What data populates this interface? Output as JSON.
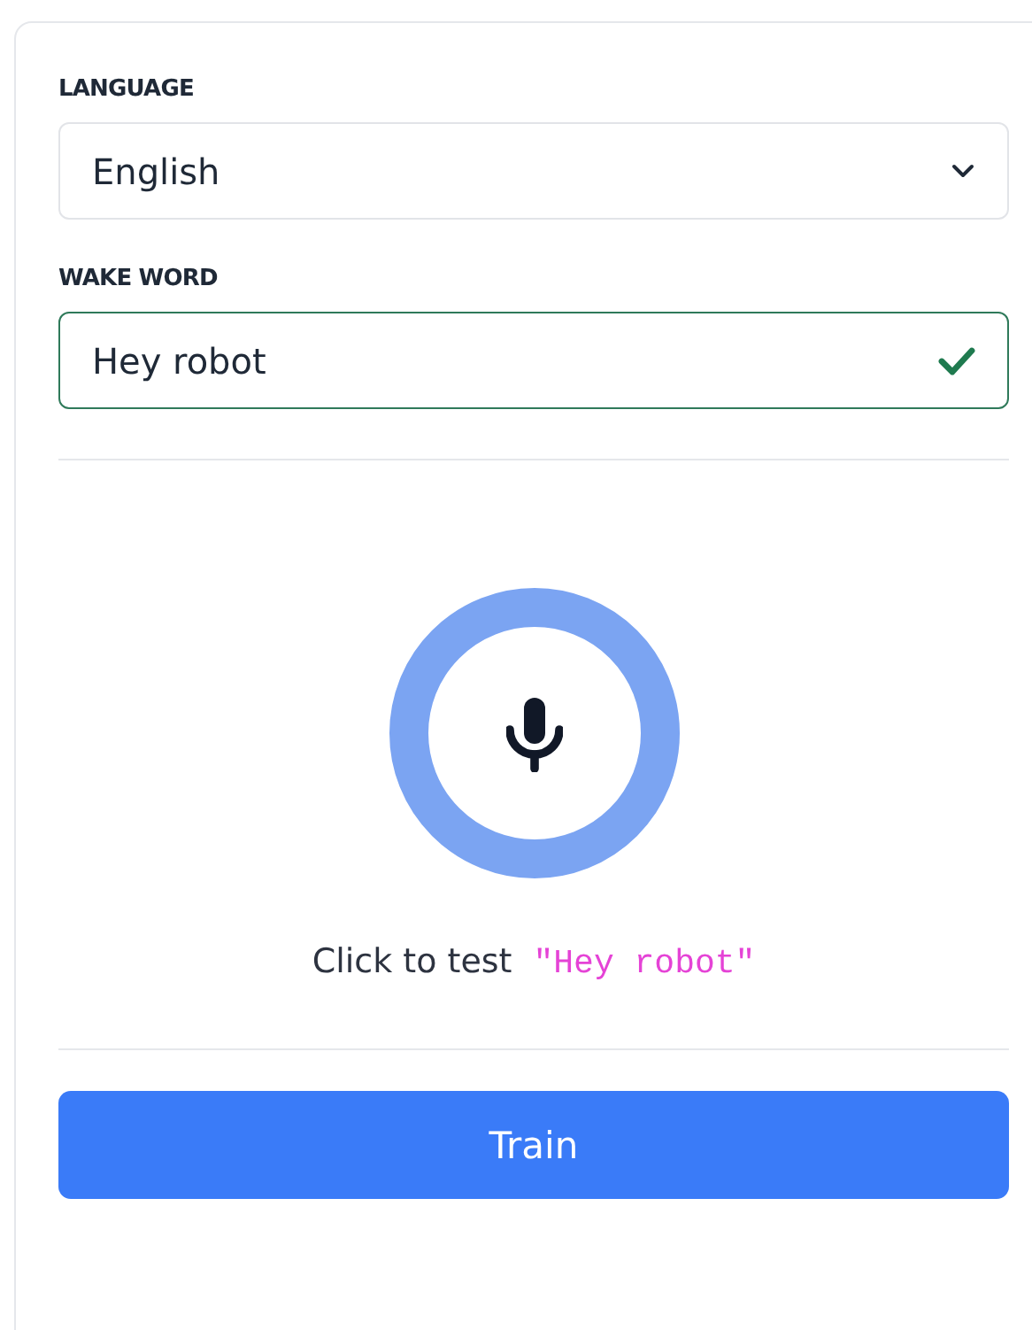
{
  "language": {
    "label": "LANGUAGE",
    "value": "English"
  },
  "wake_word": {
    "label": "WAKE WORD",
    "value": "Hey robot",
    "valid": true
  },
  "test": {
    "prompt": "Click to test",
    "phrase": "\"Hey robot\""
  },
  "buttons": [
    {
      "label": "Train"
    }
  ]
}
